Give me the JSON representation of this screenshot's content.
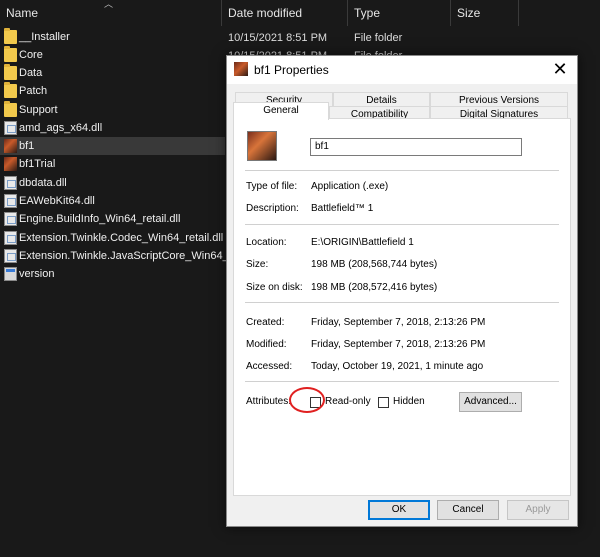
{
  "explorer": {
    "columns": {
      "name": "Name",
      "date_modified": "Date modified",
      "type": "Type",
      "size": "Size"
    },
    "files": [
      {
        "name": "__Installer",
        "kind": "folder"
      },
      {
        "name": "Core",
        "kind": "folder"
      },
      {
        "name": "Data",
        "kind": "folder"
      },
      {
        "name": "Patch",
        "kind": "folder"
      },
      {
        "name": "Support",
        "kind": "folder"
      },
      {
        "name": "amd_ags_x64.dll",
        "kind": "dll"
      },
      {
        "name": "bf1",
        "kind": "exe",
        "selected": true
      },
      {
        "name": "bf1Trial",
        "kind": "exe"
      },
      {
        "name": "dbdata.dll",
        "kind": "dll"
      },
      {
        "name": "EAWebKit64.dll",
        "kind": "dll"
      },
      {
        "name": "Engine.BuildInfo_Win64_retail.dll",
        "kind": "dll"
      },
      {
        "name": "Extension.Twinkle.Codec_Win64_retail.dll",
        "kind": "dll"
      },
      {
        "name": "Extension.Twinkle.JavaScriptCore_Win64_...",
        "kind": "dll"
      },
      {
        "name": "version",
        "kind": "text"
      }
    ],
    "row0": {
      "date": "10/15/2021 8:51 PM",
      "type": "File folder"
    },
    "row1": {
      "date": "10/15/2021 8:51 PM",
      "type": "File folder"
    }
  },
  "dialog": {
    "title": "bf1 Properties",
    "close_glyph": "✕",
    "tabs_back": [
      "Security",
      "Details",
      "Previous Versions"
    ],
    "tabs_front": [
      "General",
      "Compatibility",
      "Digital Signatures"
    ],
    "file_name": "bf1",
    "type_of_file_label": "Type of file:",
    "type_of_file": "Application (.exe)",
    "description_label": "Description:",
    "description": "Battlefield™ 1",
    "location_label": "Location:",
    "location": "E:\\ORIGIN\\Battlefield 1",
    "size_label": "Size:",
    "size": "198 MB (208,568,744 bytes)",
    "size_on_disk_label": "Size on disk:",
    "size_on_disk": "198 MB (208,572,416 bytes)",
    "created_label": "Created:",
    "created": "Friday, September 7, 2018, 2:13:26 PM",
    "modified_label": "Modified:",
    "modified": "Friday, September 7, 2018, 2:13:26 PM",
    "accessed_label": "Accessed:",
    "accessed": "Today, October 19, 2021, 1 minute ago",
    "attributes_label": "Attributes:",
    "readonly_label": "Read-only",
    "hidden_label": "Hidden",
    "advanced_label": "Advanced...",
    "ok_label": "OK",
    "cancel_label": "Cancel",
    "apply_label": "Apply"
  }
}
